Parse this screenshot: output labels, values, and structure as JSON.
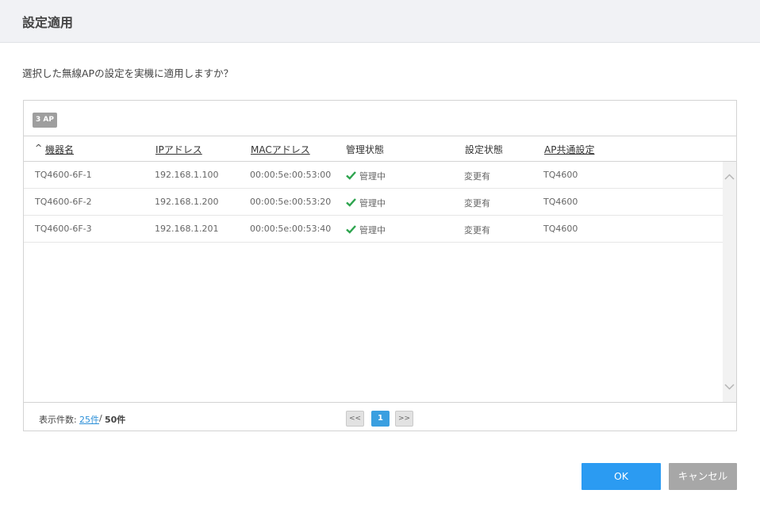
{
  "dialog": {
    "title": "設定適用",
    "message": "選択した無線APの設定を実機に適用しますか？"
  },
  "table": {
    "badge": "3 AP",
    "sort_indicator": "^",
    "columns": {
      "device_name": "機器名",
      "ip": "IPアドレス",
      "mac": "MACアドレス",
      "mgmt_state": "管理状態",
      "config_state": "設定状態",
      "ap_common": "AP共通設定"
    },
    "rows": [
      {
        "device_name": "TQ4600-6F-1",
        "ip": "192.168.1.100",
        "mac": "00:00:5e:00:53:00",
        "mgmt_state": "管理中",
        "config_state": "変更有",
        "ap_common": "TQ4600"
      },
      {
        "device_name": "TQ4600-6F-2",
        "ip": "192.168.1.200",
        "mac": "00:00:5e:00:53:20",
        "mgmt_state": "管理中",
        "config_state": "変更有",
        "ap_common": "TQ4600"
      },
      {
        "device_name": "TQ4600-6F-3",
        "ip": "192.168.1.201",
        "mac": "00:00:5e:00:53:40",
        "mgmt_state": "管理中",
        "config_state": "変更有",
        "ap_common": "TQ4600"
      }
    ],
    "status_color": "#2da44e"
  },
  "footer": {
    "count_label": "表示件数:",
    "page_size": "25件",
    "separator": "/",
    "total": "50件",
    "prev_label": "<<",
    "current_page": "1",
    "next_label": ">>"
  },
  "buttons": {
    "ok": "OK",
    "cancel": "キャンセル"
  },
  "colors": {
    "primary": "#2b9bf2",
    "secondary": "#a7a7a7",
    "link": "#2b8fd8"
  }
}
